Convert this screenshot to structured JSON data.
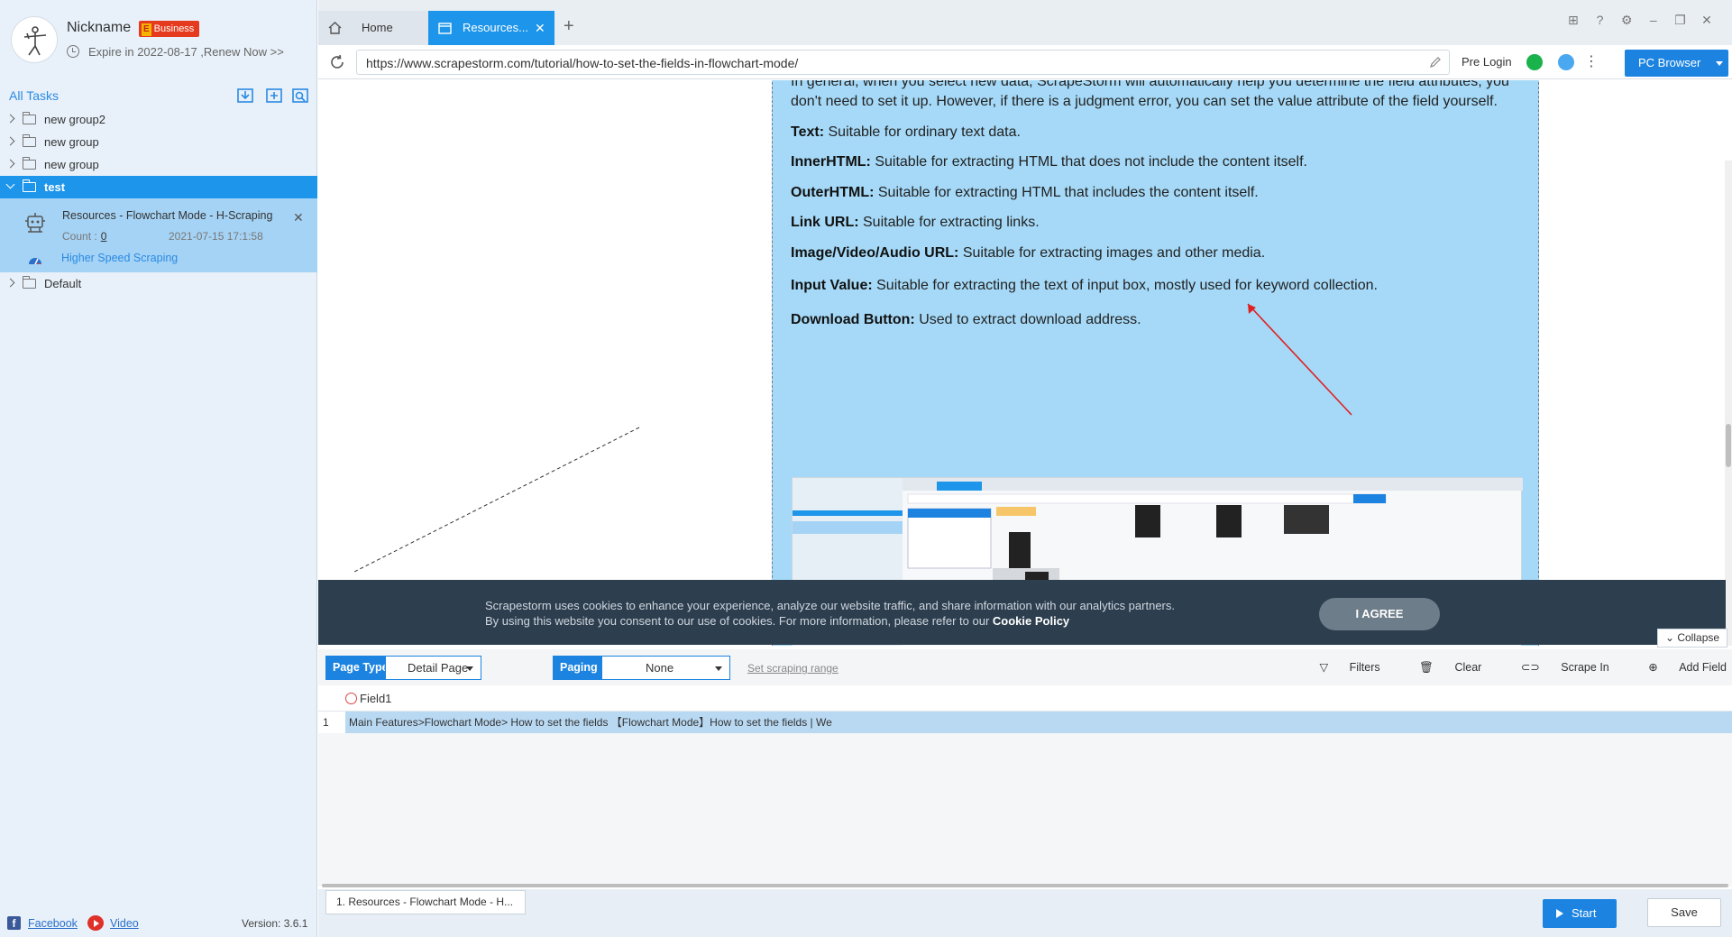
{
  "profile": {
    "nickname": "Nickname",
    "badge_letter": "E",
    "badge_label": "Business",
    "expire_text": "Expire in 2022-08-17 ,Renew Now >>"
  },
  "tasks": {
    "title": "All Tasks",
    "groups": [
      {
        "label": "new group2"
      },
      {
        "label": "new group"
      },
      {
        "label": "new group"
      },
      {
        "label": "test"
      },
      {
        "label": "Default"
      }
    ],
    "active_task": {
      "name": "Resources - Flowchart Mode - H-Scraping",
      "count_label": "Count :",
      "count_value": "0",
      "date": "2021-07-15 17:1:58",
      "speed_label": "Higher Speed Scraping"
    }
  },
  "footer_links": {
    "facebook": "Facebook",
    "video": "Video",
    "version": "Version: 3.6.1"
  },
  "tabs": {
    "home": "Home",
    "resources": "Resources..."
  },
  "address": {
    "url": "https://www.scrapestorm.com/tutorial/how-to-set-the-fields-in-flowchart-mode/",
    "pre_login": "Pre Login",
    "browser_label": "PC Browser"
  },
  "article": {
    "intro_1": "In general, when you select new data, ScrapeStorm will automatically help you determine the field attributes, you",
    "intro_2": "don't need to set it up. However, if there is a judgment error, you can set the value attribute of the field yourself.",
    "items": [
      {
        "term": "Text:",
        "desc": " Suitable for ordinary text data."
      },
      {
        "term": "InnerHTML:",
        "desc": " Suitable for extracting HTML that does not include the content itself."
      },
      {
        "term": "OuterHTML:",
        "desc": " Suitable for extracting HTML that includes the content itself."
      },
      {
        "term": "Link URL:",
        "desc": " Suitable for extracting links."
      },
      {
        "term": "Image/Video/Audio URL:",
        "desc": " Suitable for extracting images and other media."
      },
      {
        "term": "Input Value:",
        "desc": " Suitable for extracting the text of input box, mostly used for keyword collection."
      },
      {
        "term": "Download Button:",
        "desc": " Used to extract download address."
      }
    ]
  },
  "cookie": {
    "line1": "Scrapestorm uses cookies to enhance your experience, analyze our website traffic, and share information with our analytics partners.",
    "line2_prefix": "By using this website you consent to our use of cookies. For more information, please refer to our ",
    "line2_link": "Cookie Policy",
    "agree": "I AGREE",
    "collapse": "Collapse"
  },
  "toolbar": {
    "page_type_label": "Page Type",
    "page_type_value": "Detail Page",
    "paging_label": "Paging",
    "paging_value": "None",
    "range_link": "Set scraping range",
    "filters": "Filters",
    "clear": "Clear",
    "scrape_in": "Scrape In",
    "add_field": "Add Field"
  },
  "grid": {
    "field_header": "Field1",
    "rows": [
      {
        "index": "1",
        "value": "Main Features>Flowchart Mode> How to set the fields 【Flowchart Mode】How to set the fields | We"
      }
    ]
  },
  "footer": {
    "tab_label": "1. Resources - Flowchart Mode - H...",
    "start": "Start",
    "save": "Save"
  },
  "colors": {
    "accent": "#1c84e0",
    "active_row": "#1c95ea",
    "highlight": "#a5d9f7",
    "cookie_bg": "#2d3e4e"
  }
}
